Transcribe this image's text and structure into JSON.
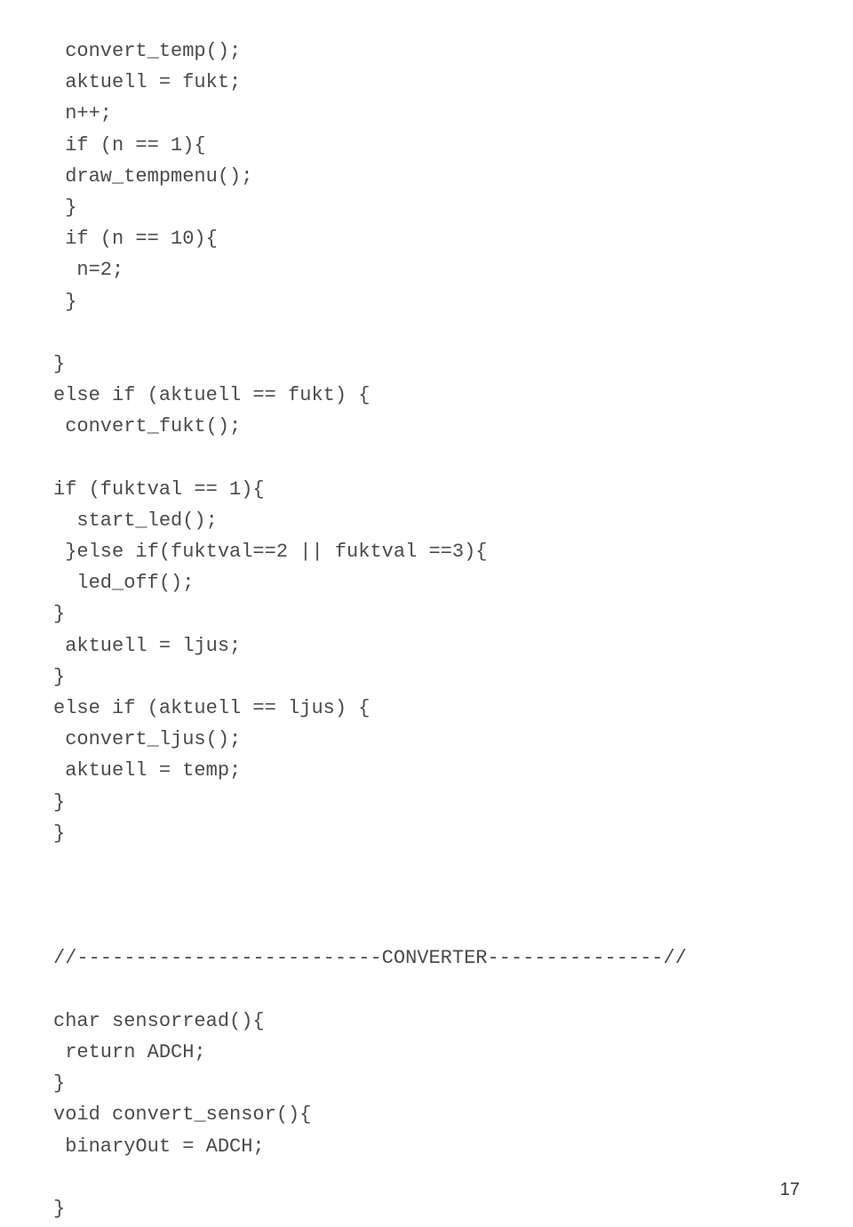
{
  "code_lines": [
    " convert_temp();",
    " aktuell = fukt;",
    " n++;",
    " if (n == 1){",
    " draw_tempmenu();",
    " }",
    " if (n == 10){",
    "  n=2;",
    " }",
    "",
    "}",
    "else if (aktuell == fukt) {",
    " convert_fukt();",
    "",
    "if (fuktval == 1){",
    "  start_led();",
    " }else if(fuktval==2 || fuktval ==3){",
    "  led_off();",
    "}",
    " aktuell = ljus;",
    "}",
    "else if (aktuell == ljus) {",
    " convert_ljus();",
    " aktuell = temp;",
    "}",
    "}",
    "",
    "",
    "",
    "//--------------------------CONVERTER---------------//",
    "",
    "char sensorread(){",
    " return ADCH;",
    "}",
    "void convert_sensor(){",
    " binaryOut = ADCH;",
    "",
    "}"
  ],
  "page_number": "17"
}
